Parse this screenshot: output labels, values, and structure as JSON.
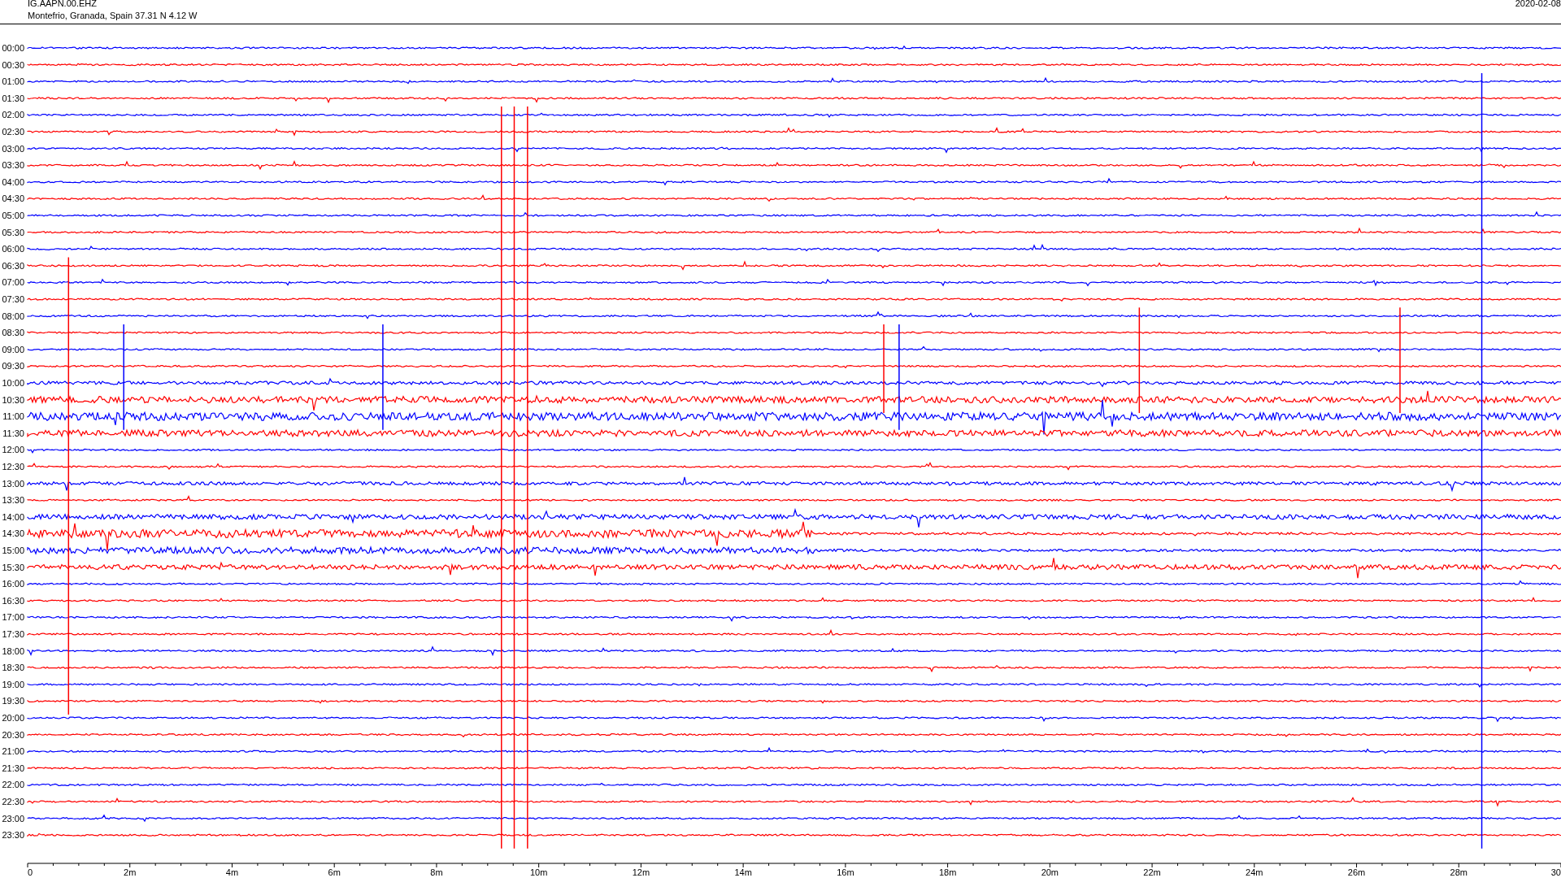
{
  "header": {
    "station": "IG.AAPN.00.EHZ",
    "location": "Montefrio, Granada, Spain  37.31 N 4.12 W",
    "date": "2020-02-08"
  },
  "traces": [
    {
      "label": "00:00",
      "color": "#0000ff"
    },
    {
      "label": "00:30",
      "color": "#ff0000"
    },
    {
      "label": "01:00",
      "color": "#0000ff"
    },
    {
      "label": "01:30",
      "color": "#ff0000"
    },
    {
      "label": "02:00",
      "color": "#0000ff"
    },
    {
      "label": "02:30",
      "color": "#ff0000"
    },
    {
      "label": "03:00",
      "color": "#0000ff"
    },
    {
      "label": "03:30",
      "color": "#ff0000"
    },
    {
      "label": "04:00",
      "color": "#0000ff"
    },
    {
      "label": "04:30",
      "color": "#ff0000"
    },
    {
      "label": "05:00",
      "color": "#0000ff"
    },
    {
      "label": "05:30",
      "color": "#ff0000"
    },
    {
      "label": "06:00",
      "color": "#0000ff"
    },
    {
      "label": "06:30",
      "color": "#ff0000"
    },
    {
      "label": "07:00",
      "color": "#0000ff"
    },
    {
      "label": "07:30",
      "color": "#ff0000"
    },
    {
      "label": "08:00",
      "color": "#0000ff"
    },
    {
      "label": "08:30",
      "color": "#ff0000"
    },
    {
      "label": "09:00",
      "color": "#0000ff"
    },
    {
      "label": "09:30",
      "color": "#ff0000"
    },
    {
      "label": "10:00",
      "color": "#0000ff"
    },
    {
      "label": "10:30",
      "color": "#ff0000"
    },
    {
      "label": "11:00",
      "color": "#0000ff"
    },
    {
      "label": "11:30",
      "color": "#ff0000"
    },
    {
      "label": "12:00",
      "color": "#0000ff"
    },
    {
      "label": "12:30",
      "color": "#ff0000"
    },
    {
      "label": "13:00",
      "color": "#0000ff"
    },
    {
      "label": "13:30",
      "color": "#ff0000"
    },
    {
      "label": "14:00",
      "color": "#0000ff"
    },
    {
      "label": "14:30",
      "color": "#ff0000"
    },
    {
      "label": "15:00",
      "color": "#0000ff"
    },
    {
      "label": "15:30",
      "color": "#ff0000"
    },
    {
      "label": "16:00",
      "color": "#0000ff"
    },
    {
      "label": "16:30",
      "color": "#ff0000"
    },
    {
      "label": "17:00",
      "color": "#0000ff"
    },
    {
      "label": "17:30",
      "color": "#ff0000"
    },
    {
      "label": "18:00",
      "color": "#0000ff"
    },
    {
      "label": "18:30",
      "color": "#ff0000"
    },
    {
      "label": "19:00",
      "color": "#0000ff"
    },
    {
      "label": "19:30",
      "color": "#ff0000"
    },
    {
      "label": "20:00",
      "color": "#0000ff"
    },
    {
      "label": "20:30",
      "color": "#ff0000"
    },
    {
      "label": "21:00",
      "color": "#0000ff"
    },
    {
      "label": "21:30",
      "color": "#ff0000"
    },
    {
      "label": "22:00",
      "color": "#0000ff"
    },
    {
      "label": "22:30",
      "color": "#ff0000"
    },
    {
      "label": "23:00",
      "color": "#0000ff"
    },
    {
      "label": "23:30",
      "color": "#ff0000"
    }
  ],
  "axis": {
    "labels": [
      "0",
      "2m",
      "4m",
      "6m",
      "8m",
      "10m",
      "12m",
      "14m",
      "16m",
      "18m",
      "20m",
      "22m",
      "24m",
      "26m",
      "28m",
      "30"
    ]
  }
}
